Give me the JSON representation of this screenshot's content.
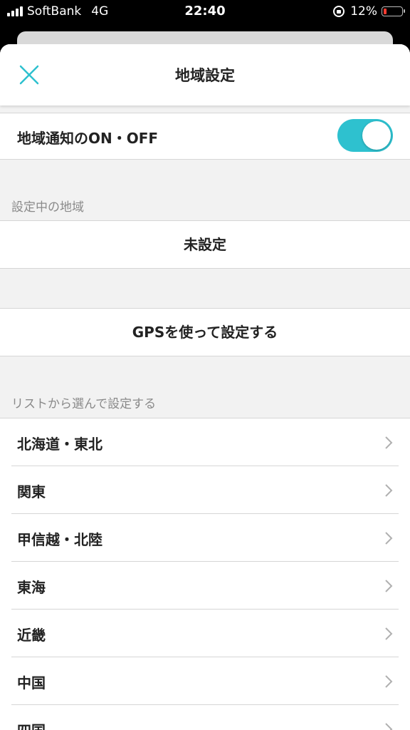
{
  "status_bar": {
    "carrier": "SoftBank",
    "network": "4G",
    "time": "22:40",
    "battery": "12%"
  },
  "header": {
    "title": "地域設定"
  },
  "toggle": {
    "label": "地域通知のON・OFF",
    "state": "on",
    "color": "#2ec1cf"
  },
  "current_region": {
    "section_title": "設定中の地域",
    "value": "未設定"
  },
  "gps": {
    "label": "GPSを使って設定する"
  },
  "region_list": {
    "section_title": "リストから選んで設定する",
    "items": [
      "北海道・東北",
      "関東",
      "甲信越・北陸",
      "東海",
      "近畿",
      "中国",
      "四国"
    ]
  }
}
